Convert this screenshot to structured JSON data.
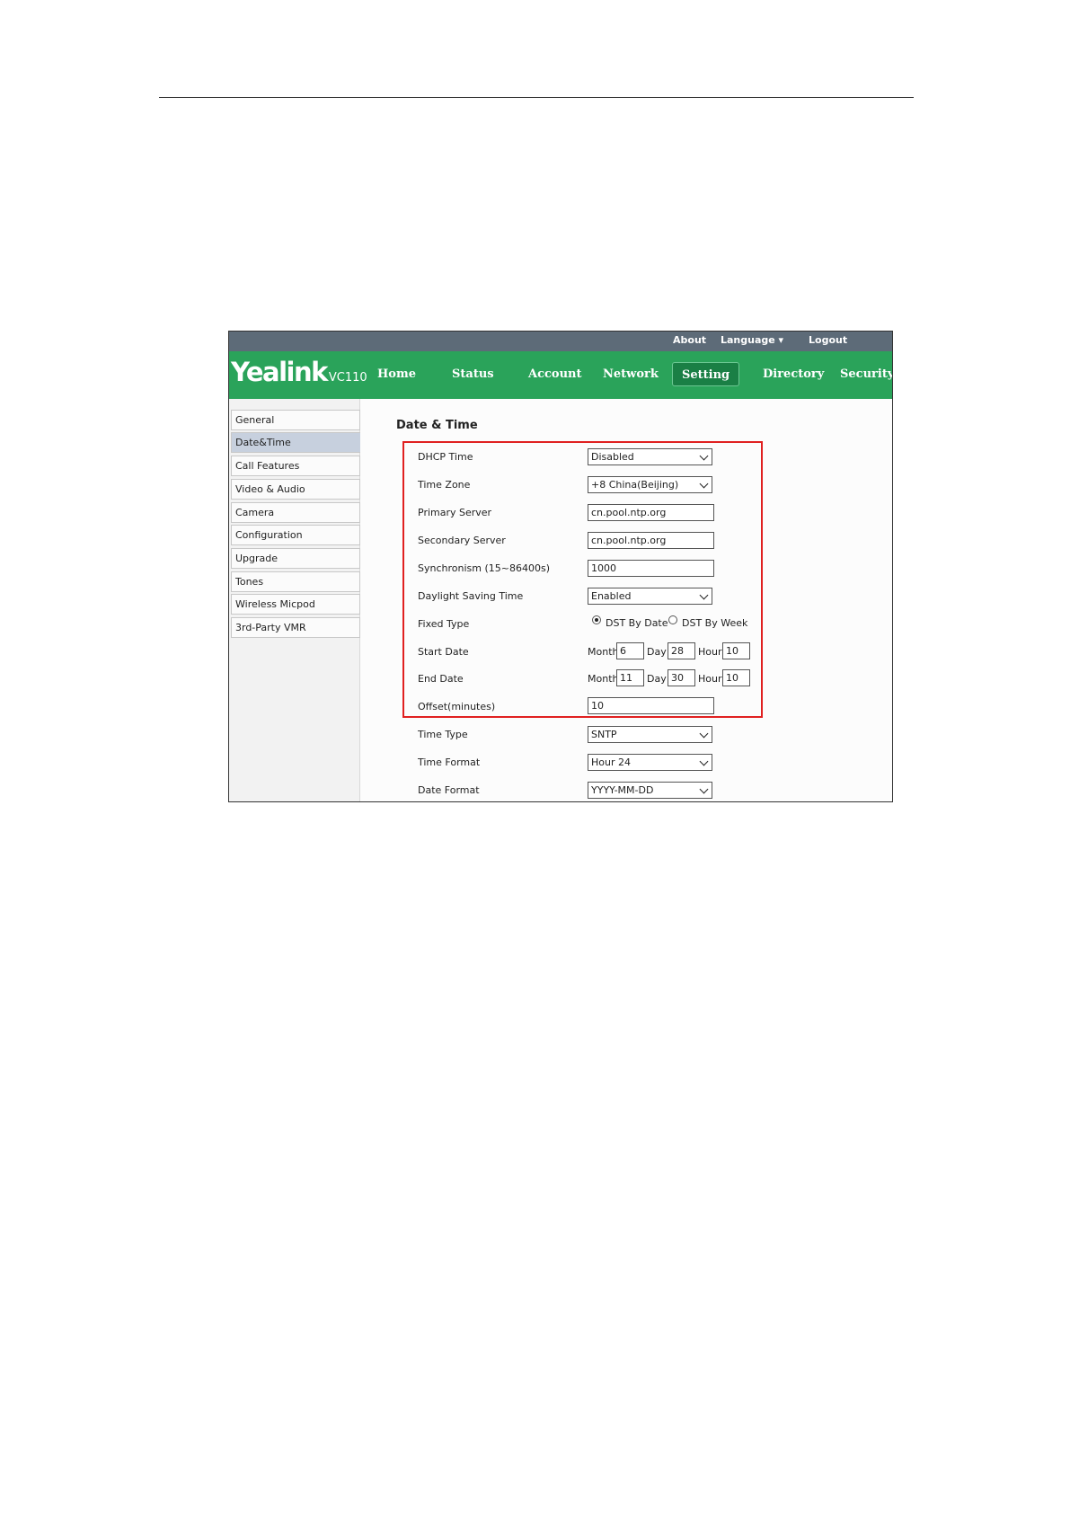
{
  "topbar": {
    "about": "About",
    "language": "Language ▾",
    "logout": "Logout"
  },
  "brand": {
    "logo": "Yealink",
    "model": "VC110"
  },
  "nav": {
    "tabs": [
      "Home",
      "Status",
      "Account",
      "Network",
      "Setting",
      "Directory",
      "Security"
    ],
    "active": "Setting"
  },
  "sidebar": {
    "items": [
      "General",
      "Date&Time",
      "Call Features",
      "Video & Audio",
      "Camera",
      "Configuration",
      "Upgrade",
      "Tones",
      "Wireless Micpod",
      "3rd-Party VMR"
    ],
    "active": "Date&Time"
  },
  "page": {
    "title": "Date & Time"
  },
  "form": {
    "dhcp_time": {
      "label": "DHCP Time",
      "value": "Disabled"
    },
    "time_zone": {
      "label": "Time Zone",
      "value": "+8 China(Beijing)"
    },
    "primary_server": {
      "label": "Primary Server",
      "value": "cn.pool.ntp.org"
    },
    "secondary_server": {
      "label": "Secondary Server",
      "value": "cn.pool.ntp.org"
    },
    "synchronism": {
      "label": "Synchronism (15~86400s)",
      "value": "1000"
    },
    "dst": {
      "label": "Daylight Saving Time",
      "value": "Enabled"
    },
    "fixed_type": {
      "label": "Fixed Type",
      "option1": "DST By Date",
      "option2": "DST By Week",
      "selected": "DST By Date"
    },
    "start_date": {
      "label": "Start Date",
      "month_label": "Month",
      "month": "6",
      "day_label": "Day",
      "day": "28",
      "hour_label": "Hour",
      "hour": "10"
    },
    "end_date": {
      "label": "End Date",
      "month_label": "Month",
      "month": "11",
      "day_label": "Day",
      "day": "30",
      "hour_label": "Hour",
      "hour": "10"
    },
    "offset": {
      "label": "Offset(minutes)",
      "value": "10"
    },
    "time_type": {
      "label": "Time Type",
      "value": "SNTP"
    },
    "time_format": {
      "label": "Time Format",
      "value": "Hour 24"
    },
    "date_format": {
      "label": "Date Format",
      "value": "YYYY-MM-DD"
    }
  },
  "colors": {
    "nav_green": "#2aa35a",
    "active_tab": "#1a7f45",
    "topbar": "#5d6b78",
    "highlight": "#e02020"
  }
}
